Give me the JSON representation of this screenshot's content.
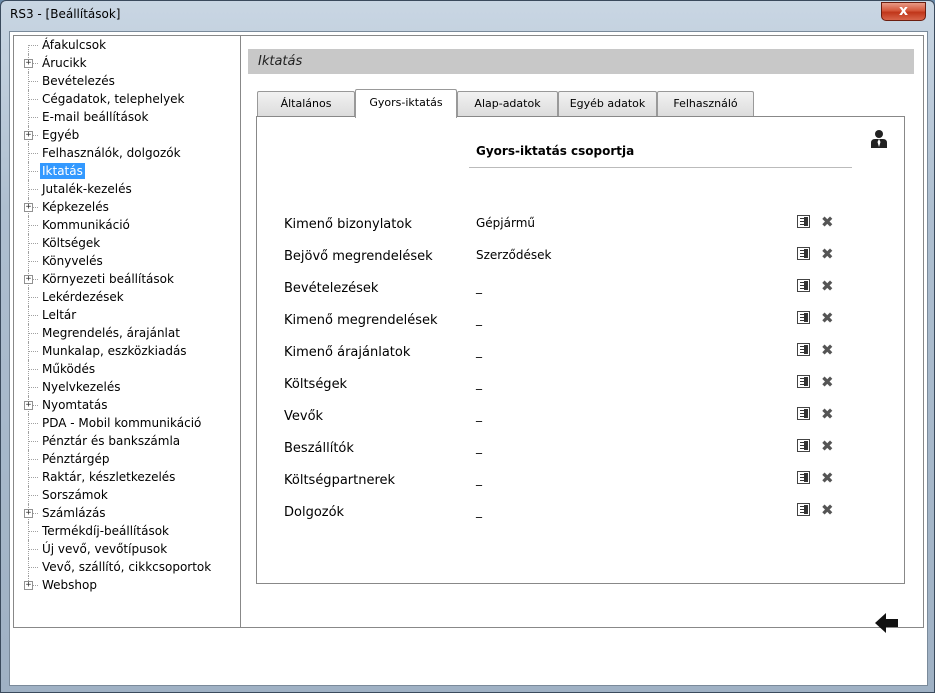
{
  "window": {
    "title": "RS3 - [Beállítások]",
    "close_label": "x"
  },
  "sidebar": {
    "items": [
      {
        "label": "Áfakulcsok",
        "expandable": false
      },
      {
        "label": "Árucikk",
        "expandable": true
      },
      {
        "label": "Bevételezés",
        "expandable": false
      },
      {
        "label": "Cégadatok, telephelyek",
        "expandable": false
      },
      {
        "label": "E-mail beállítások",
        "expandable": false
      },
      {
        "label": "Egyéb",
        "expandable": true
      },
      {
        "label": "Felhasználók, dolgozók",
        "expandable": false
      },
      {
        "label": "Iktatás",
        "expandable": false,
        "selected": true
      },
      {
        "label": "Jutalék-kezelés",
        "expandable": false
      },
      {
        "label": "Képkezelés",
        "expandable": true
      },
      {
        "label": "Kommunikáció",
        "expandable": false
      },
      {
        "label": "Költségek",
        "expandable": false
      },
      {
        "label": "Könyvelés",
        "expandable": false
      },
      {
        "label": "Környezeti beállítások",
        "expandable": true
      },
      {
        "label": "Lekérdezések",
        "expandable": false
      },
      {
        "label": "Leltár",
        "expandable": false
      },
      {
        "label": "Megrendelés, árajánlat",
        "expandable": false
      },
      {
        "label": "Munkalap, eszközkiadás",
        "expandable": false
      },
      {
        "label": "Működés",
        "expandable": false
      },
      {
        "label": "Nyelvkezelés",
        "expandable": false
      },
      {
        "label": "Nyomtatás",
        "expandable": true
      },
      {
        "label": "PDA - Mobil kommunikáció",
        "expandable": false
      },
      {
        "label": "Pénztár és bankszámla",
        "expandable": false
      },
      {
        "label": "Pénztárgép",
        "expandable": false
      },
      {
        "label": "Raktár, készletkezelés",
        "expandable": false
      },
      {
        "label": "Sorszámok",
        "expandable": false
      },
      {
        "label": "Számlázás",
        "expandable": true
      },
      {
        "label": "Termékdíj-beállítások",
        "expandable": false
      },
      {
        "label": "Új vevő, vevőtípusok",
        "expandable": false
      },
      {
        "label": "Vevő, szállító, cikkcsoportok",
        "expandable": false
      },
      {
        "label": "Webshop",
        "expandable": true
      }
    ]
  },
  "main": {
    "section_title": "Iktatás",
    "tabs": [
      {
        "label": "Általános",
        "active": false
      },
      {
        "label": "Gyors-iktatás",
        "active": true
      },
      {
        "label": "Alap-adatok",
        "active": false
      },
      {
        "label": "Egyéb adatok",
        "active": false
      },
      {
        "label": "Felhasználó",
        "active": false
      }
    ],
    "column_header": "Gyors-iktatás csoportja",
    "rows": [
      {
        "label": "Kimenő bizonylatok",
        "value": "Gépjármű"
      },
      {
        "label": "Bejövő megrendelések",
        "value": "Szerződések"
      },
      {
        "label": "Bevételezések",
        "value": "_"
      },
      {
        "label": "Kimenő megrendelések",
        "value": "_"
      },
      {
        "label": "Kimenő árajánlatok",
        "value": "_"
      },
      {
        "label": "Költségek",
        "value": "_"
      },
      {
        "label": "Vevők",
        "value": "_"
      },
      {
        "label": "Beszállítók",
        "value": "_"
      },
      {
        "label": "Költségpartnerek",
        "value": "_"
      },
      {
        "label": "Dolgozók",
        "value": "_"
      }
    ],
    "icons": {
      "edit": "edit-list-icon",
      "delete": "delete-x-icon",
      "user": "user-settings-icon",
      "back": "back-arrow-icon"
    }
  }
}
